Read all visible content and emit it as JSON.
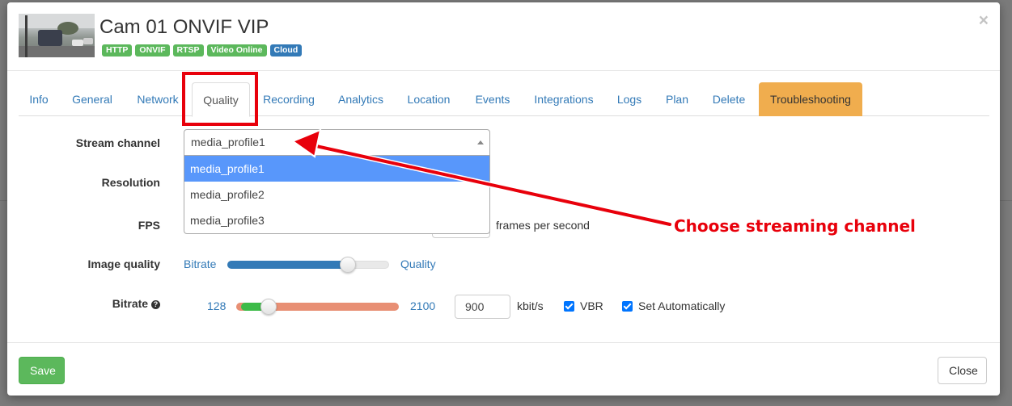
{
  "camera": {
    "title": "Cam 01 ONVIF VIP",
    "badges": [
      {
        "label": "HTTP",
        "color": "#5cb85c"
      },
      {
        "label": "ONVIF",
        "color": "#5cb85c"
      },
      {
        "label": "RTSP",
        "color": "#5cb85c"
      },
      {
        "label": "Video Online",
        "color": "#5cb85c"
      },
      {
        "label": "Cloud",
        "color": "#337ab7"
      }
    ],
    "close_glyph": "×"
  },
  "tabs": [
    {
      "label": "Info"
    },
    {
      "label": "General"
    },
    {
      "label": "Network"
    },
    {
      "label": "Quality",
      "active": true
    },
    {
      "label": "Recording"
    },
    {
      "label": "Analytics"
    },
    {
      "label": "Location"
    },
    {
      "label": "Events"
    },
    {
      "label": "Integrations"
    },
    {
      "label": "Logs"
    },
    {
      "label": "Plan"
    },
    {
      "label": "Delete"
    },
    {
      "label": "Troubleshooting",
      "color": "#f0ad4e"
    }
  ],
  "form": {
    "stream_channel": {
      "label": "Stream channel",
      "value": "media_profile1",
      "options": [
        "media_profile1",
        "media_profile2",
        "media_profile3"
      ]
    },
    "resolution": {
      "label": "Resolution"
    },
    "fps": {
      "label": "FPS",
      "unit": "frames per second"
    },
    "image_quality": {
      "label": "Image quality",
      "left_label": "Bitrate",
      "right_label": "Quality",
      "position": 0.75
    },
    "bitrate": {
      "label": "Bitrate",
      "info_glyph": "?",
      "min": "128",
      "max": "2100",
      "value": "900",
      "unit": "kbit/s",
      "vbr_label": "VBR",
      "vbr_checked": true,
      "auto_label": "Set Automatically",
      "auto_checked": true
    }
  },
  "footer": {
    "save_label": "Save",
    "close_label": "Close"
  },
  "annotation": {
    "text": "Choose streaming channel",
    "color": "#e8000b"
  }
}
